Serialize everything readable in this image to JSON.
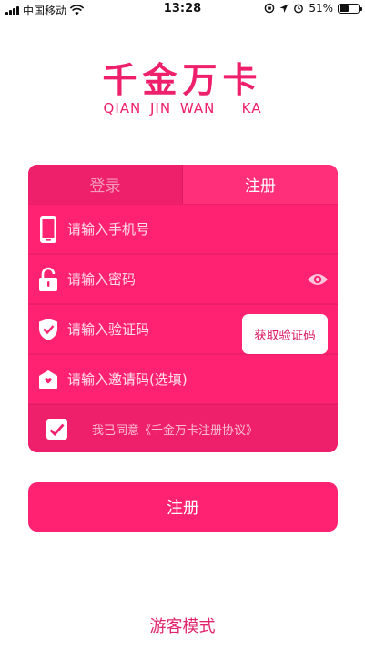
{
  "status_bar": {
    "carrier": "中国移动",
    "time": "13:28",
    "battery": "51%",
    "battery_level": 0.51
  },
  "logo": {
    "chinese": "千金万卡",
    "english": "QIAN JIN WAN   KA"
  },
  "tabs": [
    {
      "label": "登录",
      "active": false
    },
    {
      "label": "注册",
      "active": true
    }
  ],
  "form": {
    "phone_placeholder": "请输入手机号",
    "password_placeholder": "请输入密码",
    "code_placeholder": "请输入验证码",
    "invite_placeholder": "请输入邀请码(选填)",
    "get_code_label": "获取验证码",
    "agree_text": "我已同意《千金万卡注册协议》",
    "agree_checked": true
  },
  "submit_label": "注册",
  "guest_label": "游客模式",
  "colors": {
    "brand": "#ee1f6b",
    "field_bg": "#ff2272",
    "text_on_brand": "#ffffff"
  }
}
